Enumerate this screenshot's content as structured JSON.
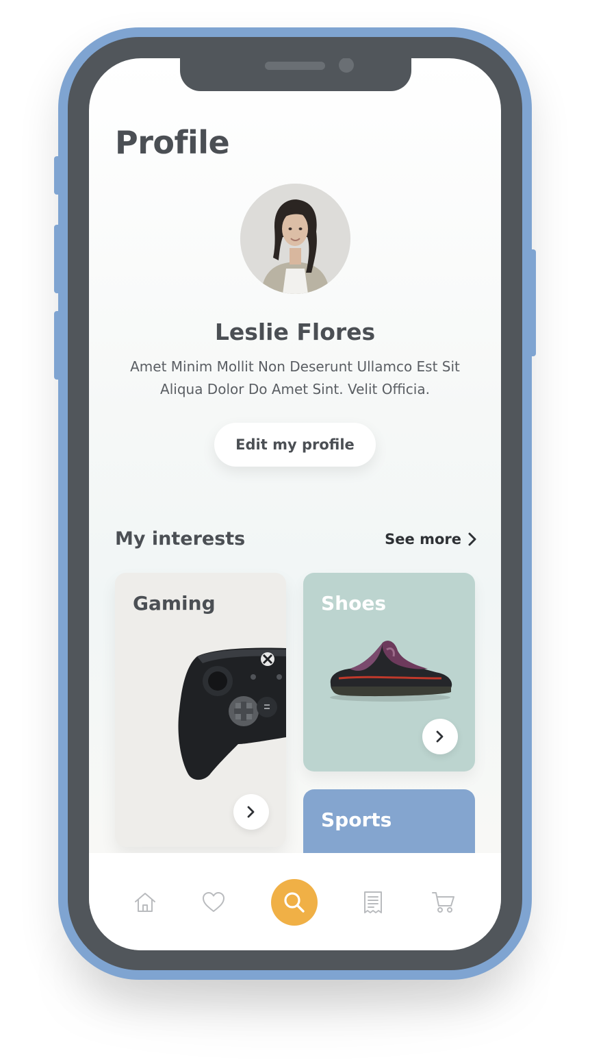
{
  "profile": {
    "title": "Profile",
    "name": "Leslie Flores",
    "bio": "Amet Minim Mollit Non Deserunt Ullamco Est Sit Aliqua Dolor Do Amet Sint. Velit Officia.",
    "edit_label": "Edit my profile"
  },
  "interests": {
    "title": "My interests",
    "see_more_label": "See more",
    "cards": [
      {
        "label": "Gaming",
        "color": "#eeedea"
      },
      {
        "label": "Shoes",
        "color": "#bcd4cf"
      },
      {
        "label": "Sports",
        "color": "#84a5cf"
      }
    ]
  },
  "tab_bar": {
    "items": [
      {
        "icon": "home-icon",
        "active": false
      },
      {
        "icon": "heart-icon",
        "active": false
      },
      {
        "icon": "search-icon",
        "active": true
      },
      {
        "icon": "receipt-icon",
        "active": false
      },
      {
        "icon": "cart-icon",
        "active": false
      }
    ]
  },
  "colors": {
    "device_frame": "#7fa4d1",
    "accent": "#f0b046",
    "text_dark": "#4b4f54"
  }
}
